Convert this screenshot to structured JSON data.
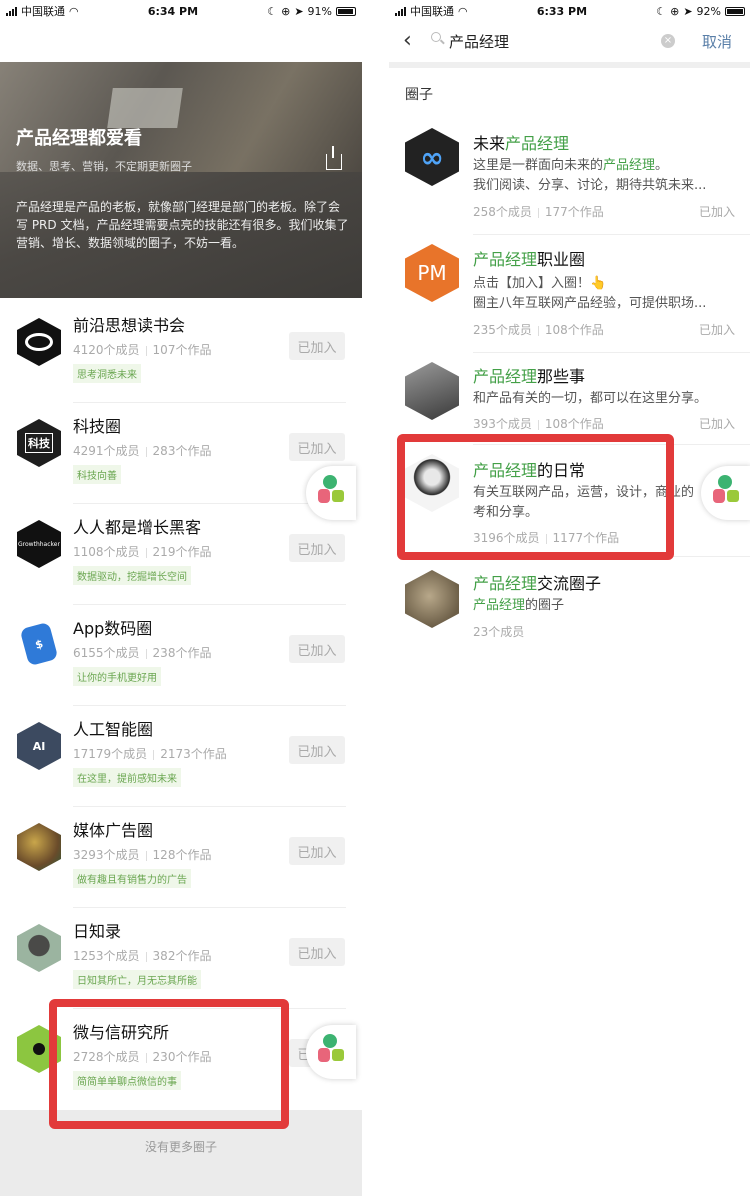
{
  "left": {
    "status": {
      "carrier": "中国联通",
      "time": "6:34 PM",
      "battery": "91%"
    },
    "hero": {
      "title": "产品经理都爱看",
      "subtitle": "数据、思考、营销，不定期更新圈子",
      "description": "产品经理是产品的老板，就像部门经理是部门的老板。除了会写 PRD 文档，产品经理需要点亮的技能还有很多。我们收集了营销、增长、数据领域的圈子，不妨一看。"
    },
    "items": [
      {
        "name": "前沿思想读书会",
        "members": "4120个成员",
        "works": "107个作品",
        "tag": "思考洞悉未来",
        "button": "已加入"
      },
      {
        "name": "科技圈",
        "members": "4291个成员",
        "works": "283个作品",
        "tag": "科技向善",
        "button": "已加入",
        "avatar_text": "科技"
      },
      {
        "name": "人人都是增长黑客",
        "members": "1108个成员",
        "works": "219个作品",
        "tag": "数据驱动，挖掘增长空间",
        "button": "已加入",
        "avatar_text": "Growthhacker"
      },
      {
        "name": "App数码圈",
        "members": "6155个成员",
        "works": "238个作品",
        "tag": "让你的手机更好用",
        "button": "已加入"
      },
      {
        "name": "人工智能圈",
        "members": "17179个成员",
        "works": "2173个作品",
        "tag": "在这里，提前感知未来",
        "button": "已加入",
        "avatar_text": "AI"
      },
      {
        "name": "媒体广告圈",
        "members": "3293个成员",
        "works": "128个作品",
        "tag": "做有趣且有销售力的广告",
        "button": "已加入"
      },
      {
        "name": "日知录",
        "members": "1253个成员",
        "works": "382个作品",
        "tag": "日知其所亡，月无忘其所能",
        "button": "已加入"
      },
      {
        "name": "微与信研究所",
        "members": "2728个成员",
        "works": "230个作品",
        "tag": "简简单单聊点微信的事",
        "button": "已加入"
      }
    ],
    "no_more": "没有更多圈子"
  },
  "right": {
    "status": {
      "carrier": "中国联通",
      "time": "6:33 PM",
      "battery": "92%"
    },
    "search": {
      "query": "产品经理",
      "cancel": "取消"
    },
    "section_title": "圈子",
    "results": [
      {
        "title_pre": "未来",
        "title_hl": "产品经理",
        "title_post": "",
        "line1_pre": "这里是一群面向未来的",
        "line1_hl": "产品经理",
        "line1_post": "。",
        "line2": "我们阅读、分享、讨论，期待共筑未来...",
        "members": "258个成员",
        "works": "177个作品",
        "joined": "已加入"
      },
      {
        "title_pre": "",
        "title_hl": "产品经理",
        "title_post": "职业圈",
        "line1_pre": "点击【加入】入圈！👆",
        "line1_hl": "",
        "line1_post": "",
        "line2": "圈主八年互联网产品经验，可提供职场...",
        "members": "235个成员",
        "works": "108个作品",
        "joined": "已加入",
        "avatar_text": "PM"
      },
      {
        "title_pre": "",
        "title_hl": "产品经理",
        "title_post": "那些事",
        "line1_pre": "和产品有关的一切，都可以在这里分享。",
        "line1_hl": "",
        "line1_post": "",
        "line2": "",
        "members": "393个成员",
        "works": "108个作品",
        "joined": "已加入"
      },
      {
        "title_pre": "",
        "title_hl": "产品经理",
        "title_post": "的日常",
        "line1_pre": "有关互联网产品，运营，设计，商业的思",
        "line1_hl": "",
        "line1_post": "",
        "line2": "考和分享。",
        "members": "3196个成员",
        "works": "1177个作品",
        "joined": ""
      },
      {
        "title_pre": "",
        "title_hl": "产品经理",
        "title_post": "交流圈子",
        "line1_pre": "",
        "line1_hl": "产品经理",
        "line1_post": "的圈子",
        "line2": "",
        "members": "23个成员",
        "works": "",
        "joined": ""
      }
    ]
  },
  "colors": {
    "highlight": "#43a047",
    "tag_bg": "#eff7e9",
    "annotation_red": "#e23a3a",
    "cancel_blue": "#5a7fa8"
  }
}
